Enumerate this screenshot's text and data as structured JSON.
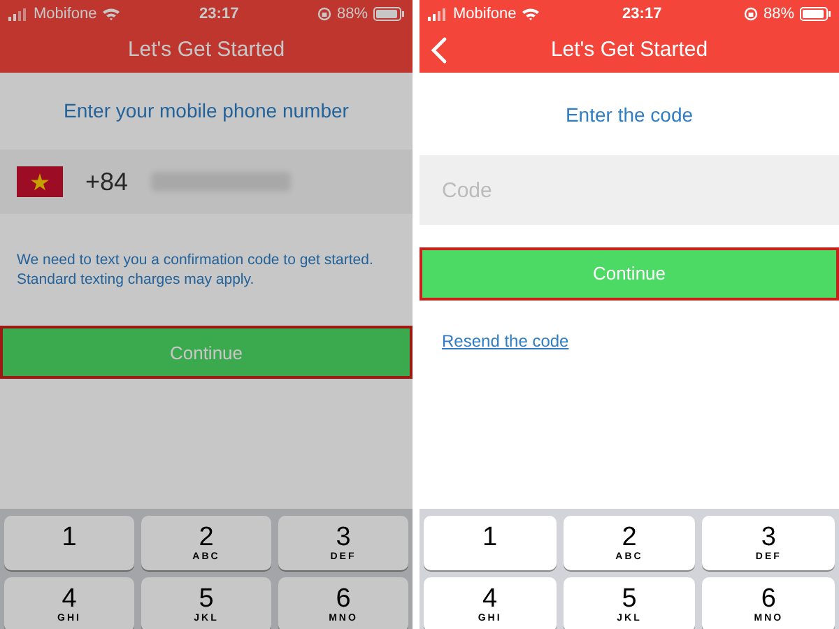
{
  "screens": [
    {
      "kind": "phone_entry",
      "dimmed": true,
      "status_bar": {
        "carrier": "Mobifone",
        "time": "23:17",
        "battery": "88%"
      },
      "header": {
        "back_button": false,
        "title": "Let's Get Started"
      },
      "prompt": "Enter your mobile phone number",
      "phone_field": {
        "country_code": "+84"
      },
      "note": "We need to text you a confirmation code to get started. Standard texting charges may apply.",
      "continue_button": {
        "label": "Continue",
        "highlighted": true
      },
      "keypad": [
        {
          "digit": "1"
        },
        {
          "digit": "2",
          "letters": "ABC"
        },
        {
          "digit": "3",
          "letters": "DEF"
        },
        {
          "digit": "4",
          "letters": "GHI"
        },
        {
          "digit": "5",
          "letters": "JKL"
        },
        {
          "digit": "6",
          "letters": "MNO"
        }
      ]
    },
    {
      "kind": "code_entry",
      "dimmed": false,
      "status_bar": {
        "carrier": "Mobifone",
        "time": "23:17",
        "battery": "88%"
      },
      "header": {
        "back_button": true,
        "title": "Let's Get Started"
      },
      "prompt": "Enter the code",
      "code_field": {
        "placeholder": "Code"
      },
      "continue_button": {
        "label": "Continue",
        "highlighted": true
      },
      "resend_link": "Resend the code",
      "keypad": [
        {
          "digit": "1"
        },
        {
          "digit": "2",
          "letters": "ABC"
        },
        {
          "digit": "3",
          "letters": "DEF"
        },
        {
          "digit": "4",
          "letters": "GHI"
        },
        {
          "digit": "5",
          "letters": "JKL"
        },
        {
          "digit": "6",
          "letters": "MNO"
        }
      ]
    }
  ]
}
